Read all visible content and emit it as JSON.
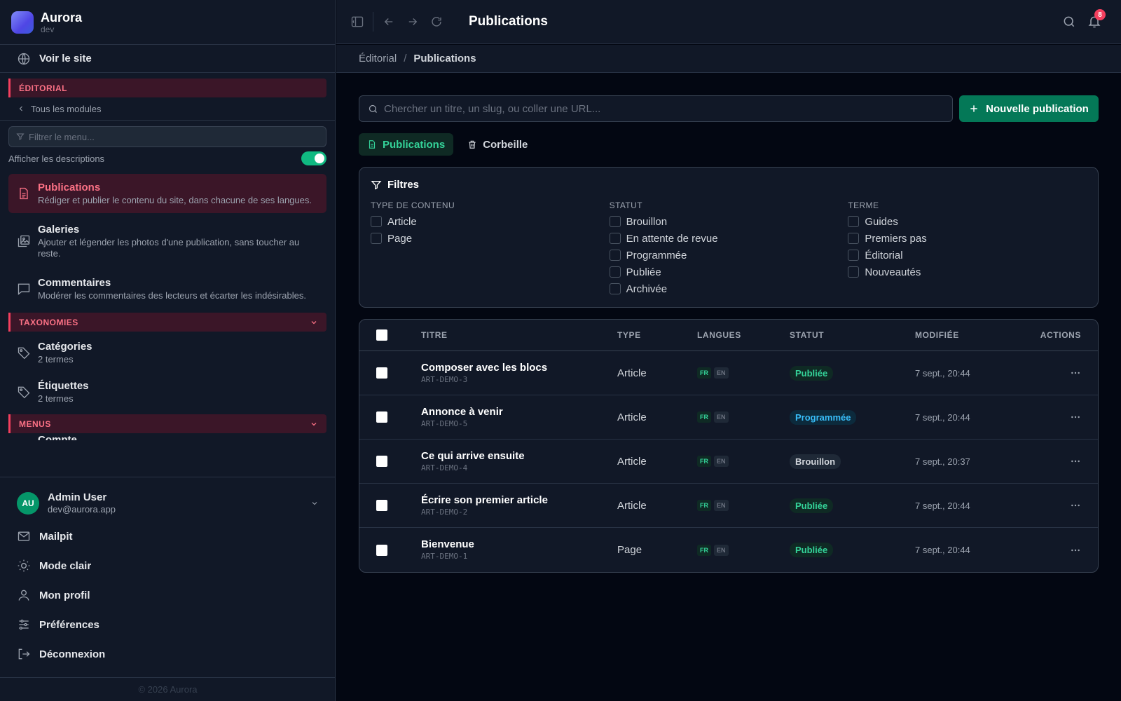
{
  "brand": {
    "name": "Aurora",
    "env": "dev"
  },
  "sidebar": {
    "visit_label": "Voir le site",
    "section_editorial": "ÉDITORIAL",
    "back_label": "Tous les modules",
    "filter_placeholder": "Filtrer le menu...",
    "show_desc_label": "Afficher les descriptions",
    "modules": [
      {
        "title": "Publications",
        "desc": "Rédiger et publier le contenu du site, dans chacune de ses langues."
      },
      {
        "title": "Galeries",
        "desc": "Ajouter et légender les photos d'une publication, sans toucher au reste."
      },
      {
        "title": "Commentaires",
        "desc": "Modérer les commentaires des lecteurs et écarter les indésirables."
      }
    ],
    "section_taxonomies": "TAXONOMIES",
    "taxonomies": [
      {
        "title": "Catégories",
        "desc": "2 termes"
      },
      {
        "title": "Étiquettes",
        "desc": "2 termes"
      }
    ],
    "section_menus": "MENUS",
    "menus_partial": "Compte"
  },
  "user": {
    "initials": "AU",
    "name": "Admin User",
    "email": "dev@aurora.app",
    "menu": [
      "Mailpit",
      "Mode clair",
      "Mon profil",
      "Préférences",
      "Déconnexion"
    ]
  },
  "footer": {
    "copyright": "© 2026 Aurora"
  },
  "topbar": {
    "title": "Publications",
    "notifications": "8"
  },
  "breadcrumb": {
    "parent": "Éditorial",
    "separator": "/",
    "current": "Publications"
  },
  "search": {
    "placeholder": "Chercher un titre, un slug, ou coller une URL..."
  },
  "new_button": "Nouvelle publication",
  "tabs": [
    "Publications",
    "Corbeille"
  ],
  "filters": {
    "title": "Filtres",
    "groups": [
      {
        "label": "TYPE DE CONTENU",
        "options": [
          "Article",
          "Page"
        ]
      },
      {
        "label": "STATUT",
        "options": [
          "Brouillon",
          "En attente de revue",
          "Programmée",
          "Publiée",
          "Archivée"
        ]
      },
      {
        "label": "TERME",
        "options": [
          "Guides",
          "Premiers pas",
          "Éditorial",
          "Nouveautés"
        ]
      }
    ]
  },
  "table": {
    "headers": {
      "title": "TITRE",
      "type": "TYPE",
      "langs": "LANGUES",
      "status": "STATUT",
      "modified": "MODIFIÉE",
      "actions": "ACTIONS"
    },
    "rows": [
      {
        "title": "Composer avec les blocs",
        "slug": "ART-DEMO-3",
        "type": "Article",
        "langs": [
          "FR",
          "EN"
        ],
        "status": "Publiée",
        "modified": "7 sept., 20:44"
      },
      {
        "title": "Annonce à venir",
        "slug": "ART-DEMO-5",
        "type": "Article",
        "langs": [
          "FR",
          "EN"
        ],
        "status": "Programmée",
        "modified": "7 sept., 20:44"
      },
      {
        "title": "Ce qui arrive ensuite",
        "slug": "ART-DEMO-4",
        "type": "Article",
        "langs": [
          "FR",
          "EN"
        ],
        "status": "Brouillon",
        "modified": "7 sept., 20:37"
      },
      {
        "title": "Écrire son premier article",
        "slug": "ART-DEMO-2",
        "type": "Article",
        "langs": [
          "FR",
          "EN"
        ],
        "status": "Publiée",
        "modified": "7 sept., 20:44"
      },
      {
        "title": "Bienvenue",
        "slug": "ART-DEMO-1",
        "type": "Page",
        "langs": [
          "FR",
          "EN"
        ],
        "status": "Publiée",
        "modified": "7 sept., 20:44"
      }
    ]
  },
  "colors": {
    "accent": "#047857",
    "rose": "#f43f5e",
    "published": "#34d399",
    "scheduled": "#38bdf8"
  }
}
